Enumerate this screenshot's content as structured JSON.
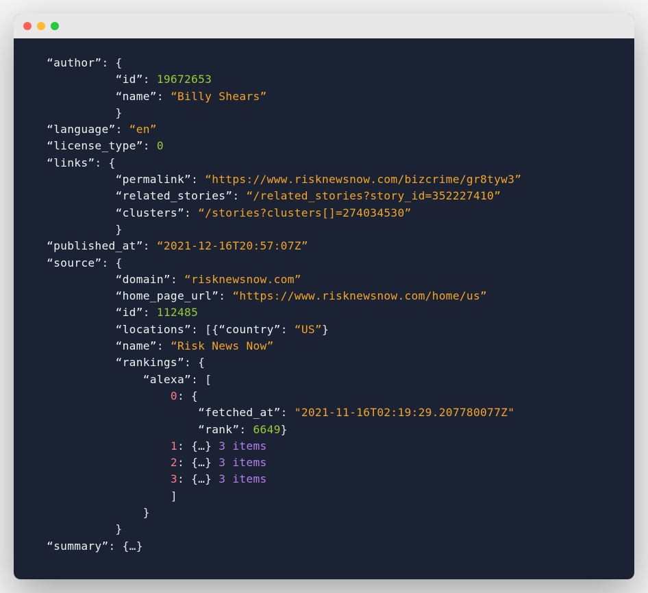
{
  "author": {
    "label_author": "author",
    "label_id": "id",
    "id_value": "19672653",
    "label_name": "name",
    "name_value": "Billy Shears"
  },
  "language": {
    "label": "language",
    "value": "en"
  },
  "license_type": {
    "label": "license_type",
    "value": "0"
  },
  "links": {
    "label": "links",
    "permalink_label": "permalink",
    "permalink_value": "https://www.risknewsnow.com/bizcrime/gr8tyw3",
    "related_label": "related_stories",
    "related_value": "/related_stories?story_id=352227410",
    "clusters_label": "clusters",
    "clusters_value": "/stories?clusters[]=274034530"
  },
  "published_at": {
    "label": "published_at",
    "value": "2021-12-16T20:57:07Z"
  },
  "source": {
    "label": "source",
    "domain_label": "domain",
    "domain_value": "risknewsnow.com",
    "home_label": "home_page_url",
    "home_value": "https://www.risknewsnow.com/home/us",
    "id_label": "id",
    "id_value": "112485",
    "locations_label": "locations",
    "country_label": "country",
    "country_value": "US",
    "name_label": "name",
    "name_value": "Risk News Now",
    "rankings_label": "rankings",
    "alexa_label": "alexa",
    "idx0": "0",
    "fetched_at_label": "fetched_at",
    "fetched_at_value": "2021-11-16T02:19:29.207780077Z",
    "rank_label": "rank",
    "rank_value": "6649",
    "idx1": "1",
    "idx2": "2",
    "idx3": "3",
    "collapsed_obj": "{…}",
    "collapsed_items": "3 items"
  },
  "summary": {
    "label": "summary",
    "collapsed": "{…}"
  }
}
